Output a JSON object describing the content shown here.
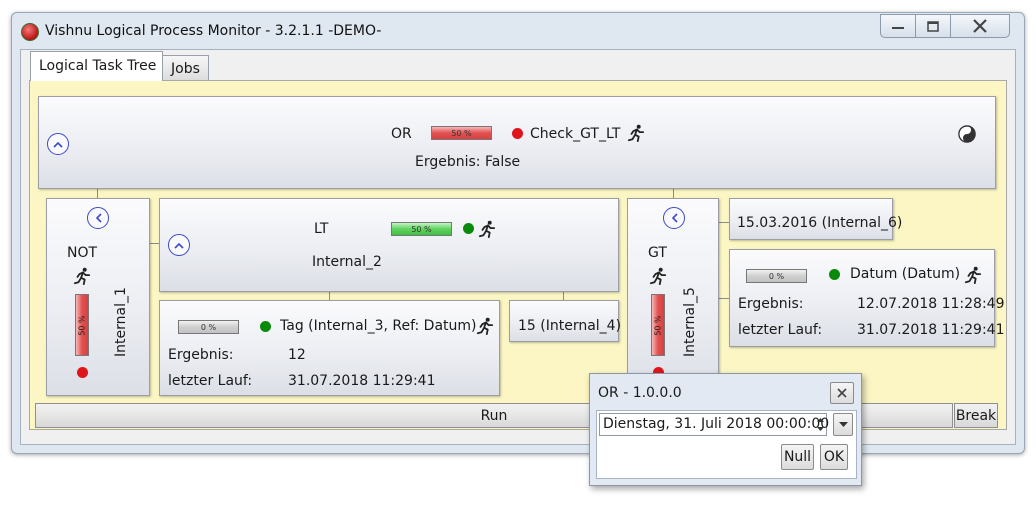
{
  "window": {
    "title": "Vishnu Logical Process Monitor - 3.2.1.1  -DEMO-"
  },
  "tabs": [
    {
      "label": "Logical Task Tree",
      "active": true
    },
    {
      "label": "Jobs",
      "active": false
    }
  ],
  "nodes": {
    "or_node": {
      "operator": "OR",
      "progress": "50 %",
      "name": "Check_GT_LT",
      "result": "Ergebnis: False",
      "status_color": "#e0141c"
    },
    "not_node": {
      "operator": "NOT",
      "progress": "50 %",
      "name": "Internal_1",
      "status_color": "#e0141c"
    },
    "lt_node": {
      "operator": "LT",
      "progress": "50 %",
      "name": "Internal_2",
      "status_color": "#0a8a0a"
    },
    "tag_node": {
      "progress": "0 %",
      "name": "Tag (Internal_3, Ref: Datum)",
      "result_label": "Ergebnis:",
      "result_value": "12",
      "last_run_label": "letzter Lauf:",
      "last_run_value": "31.07.2018 11:29:41",
      "status_color": "#0a8a0a"
    },
    "val_node": {
      "label": "15 (Internal_4)"
    },
    "gt_node": {
      "operator": "GT",
      "progress": "50 %",
      "name": "Internal_5",
      "status_color": "#e0141c"
    },
    "date_const_node": {
      "label": "15.03.2016 (Internal_6)"
    },
    "datum_node": {
      "progress": "0 %",
      "name": "Datum (Datum)",
      "result_label": "Ergebnis:",
      "result_value": "12.07.2018 11:28:49",
      "last_run_label": "letzter Lauf:",
      "last_run_value": "31.07.2018 11:29:41",
      "status_color": "#0a8a0a"
    }
  },
  "buttons": {
    "run": "Run",
    "break": "Break"
  },
  "popup": {
    "title": "OR - 1.0.0.0",
    "date_value": "Dienstag, 31. Juli 2018 00:00:00",
    "null_label": "Null",
    "ok_label": "OK"
  },
  "icons": {
    "app": "app-icon",
    "runner": "running-person-icon",
    "yin_yang": "yin-yang-icon",
    "collapse_up": "chevron-up-icon",
    "collapse_left": "chevron-left-icon"
  }
}
